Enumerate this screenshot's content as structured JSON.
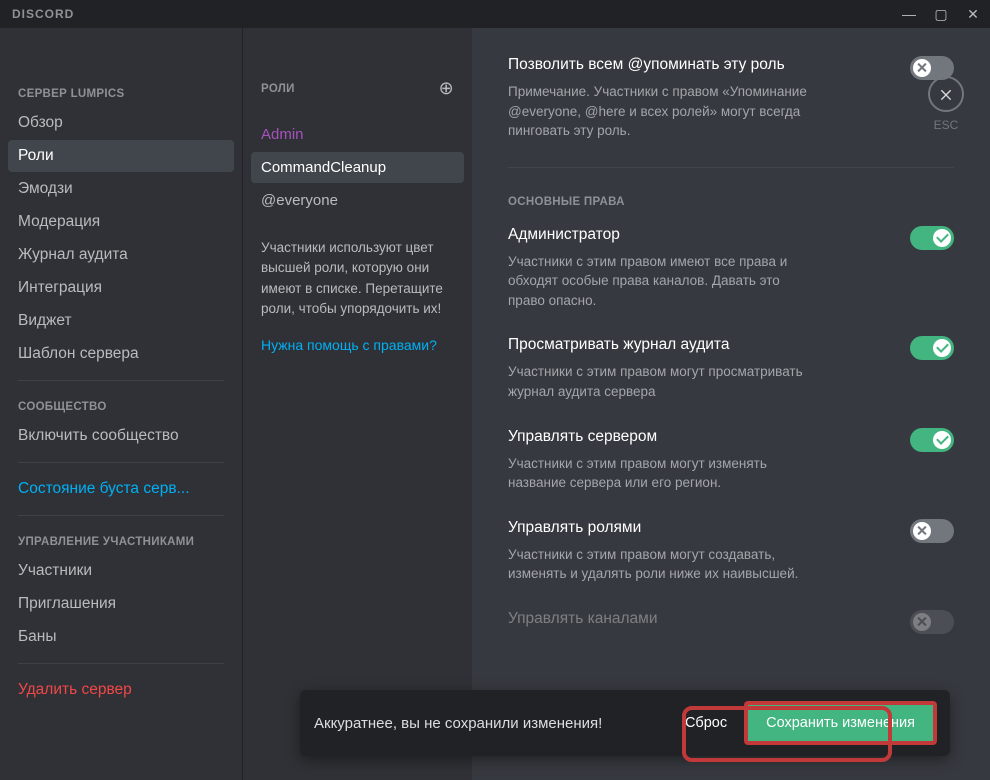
{
  "brand": "DISCORD",
  "esc_label": "ESC",
  "sidebar": {
    "cat_server": "СЕРВЕР LUMPICS",
    "items_server": [
      "Обзор",
      "Роли",
      "Эмодзи",
      "Модерация",
      "Журнал аудита",
      "Интеграция",
      "Виджет",
      "Шаблон сервера"
    ],
    "cat_community": "СООБЩЕСТВО",
    "community_item": "Включить сообщество",
    "boost_item": "Состояние буста серв...",
    "cat_members": "УПРАВЛЕНИЕ УЧАСТНИКАМИ",
    "members_items": [
      "Участники",
      "Приглашения",
      "Баны"
    ],
    "delete_item": "Удалить сервер"
  },
  "roles": {
    "header": "РОЛИ",
    "list": [
      "Admin",
      "CommandCleanup",
      "@everyone"
    ],
    "hint": "Участники используют цвет высшей роли, которую они имеют в списке. Перетащите роли, чтобы упорядочить их!",
    "help": "Нужна помощь с правами?"
  },
  "perm_mention": {
    "title": "Позволить всем @упоминать эту роль",
    "desc": "Примечание. Участники с правом «Упоминание @everyone, @here и всех ролей» могут всегда пинговать эту роль."
  },
  "section_title": "ОСНОВНЫЕ ПРАВА",
  "perm_admin": {
    "title": "Администратор",
    "desc": "Участники с этим правом имеют все права и обходят особые права каналов. Давать это право опасно."
  },
  "perm_audit": {
    "title": "Просматривать журнал аудита",
    "desc": "Участники с этим правом могут просматривать журнал аудита сервера"
  },
  "perm_server": {
    "title": "Управлять сервером",
    "desc": "Участники с этим правом могут изменять название сервера или его регион."
  },
  "perm_roles": {
    "title": "Управлять ролями",
    "desc": "Участники с этим правом могут создавать, изменять и удалять роли ниже их наивысшей."
  },
  "perm_channels": {
    "title": "Управлять каналами"
  },
  "savebar": {
    "msg": "Аккуратнее, вы не сохранили изменения!",
    "reset": "Сброс",
    "save": "Сохранить изменения"
  }
}
